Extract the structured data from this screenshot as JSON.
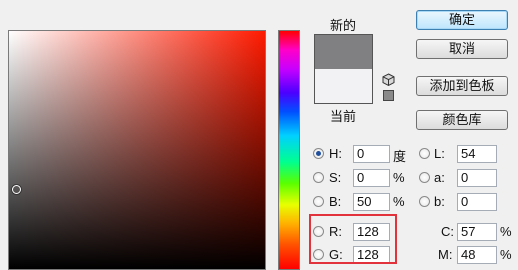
{
  "dialog": {
    "new_label": "新的",
    "current_label": "当前",
    "new_color": "#807f81",
    "current_color": "#f2f2f4"
  },
  "buttons": {
    "ok": "确定",
    "cancel": "取消",
    "add_to_swatches": "添加到色板",
    "color_libraries": "颜色库"
  },
  "hsb": {
    "h": {
      "label": "H:",
      "value": "0",
      "unit": "度"
    },
    "s": {
      "label": "S:",
      "value": "0",
      "unit": "%"
    },
    "b": {
      "label": "B:",
      "value": "50",
      "unit": "%"
    }
  },
  "lab": {
    "l": {
      "label": "L:",
      "value": "54"
    },
    "a": {
      "label": "a:",
      "value": "0"
    },
    "b": {
      "label": "b:",
      "value": "0"
    }
  },
  "rgb": {
    "r": {
      "label": "R:",
      "value": "128"
    },
    "g": {
      "label": "G:",
      "value": "128"
    }
  },
  "cmyk": {
    "c": {
      "label": "C:",
      "value": "57",
      "unit": "%"
    },
    "m": {
      "label": "M:",
      "value": "48",
      "unit": "%"
    }
  },
  "icons": {
    "gamut_warning": "cube-icon",
    "web_safe": "websafe-swatch-icon"
  },
  "colors": {
    "highlight": "#e2323c",
    "primary_button": "#bee6fd"
  }
}
